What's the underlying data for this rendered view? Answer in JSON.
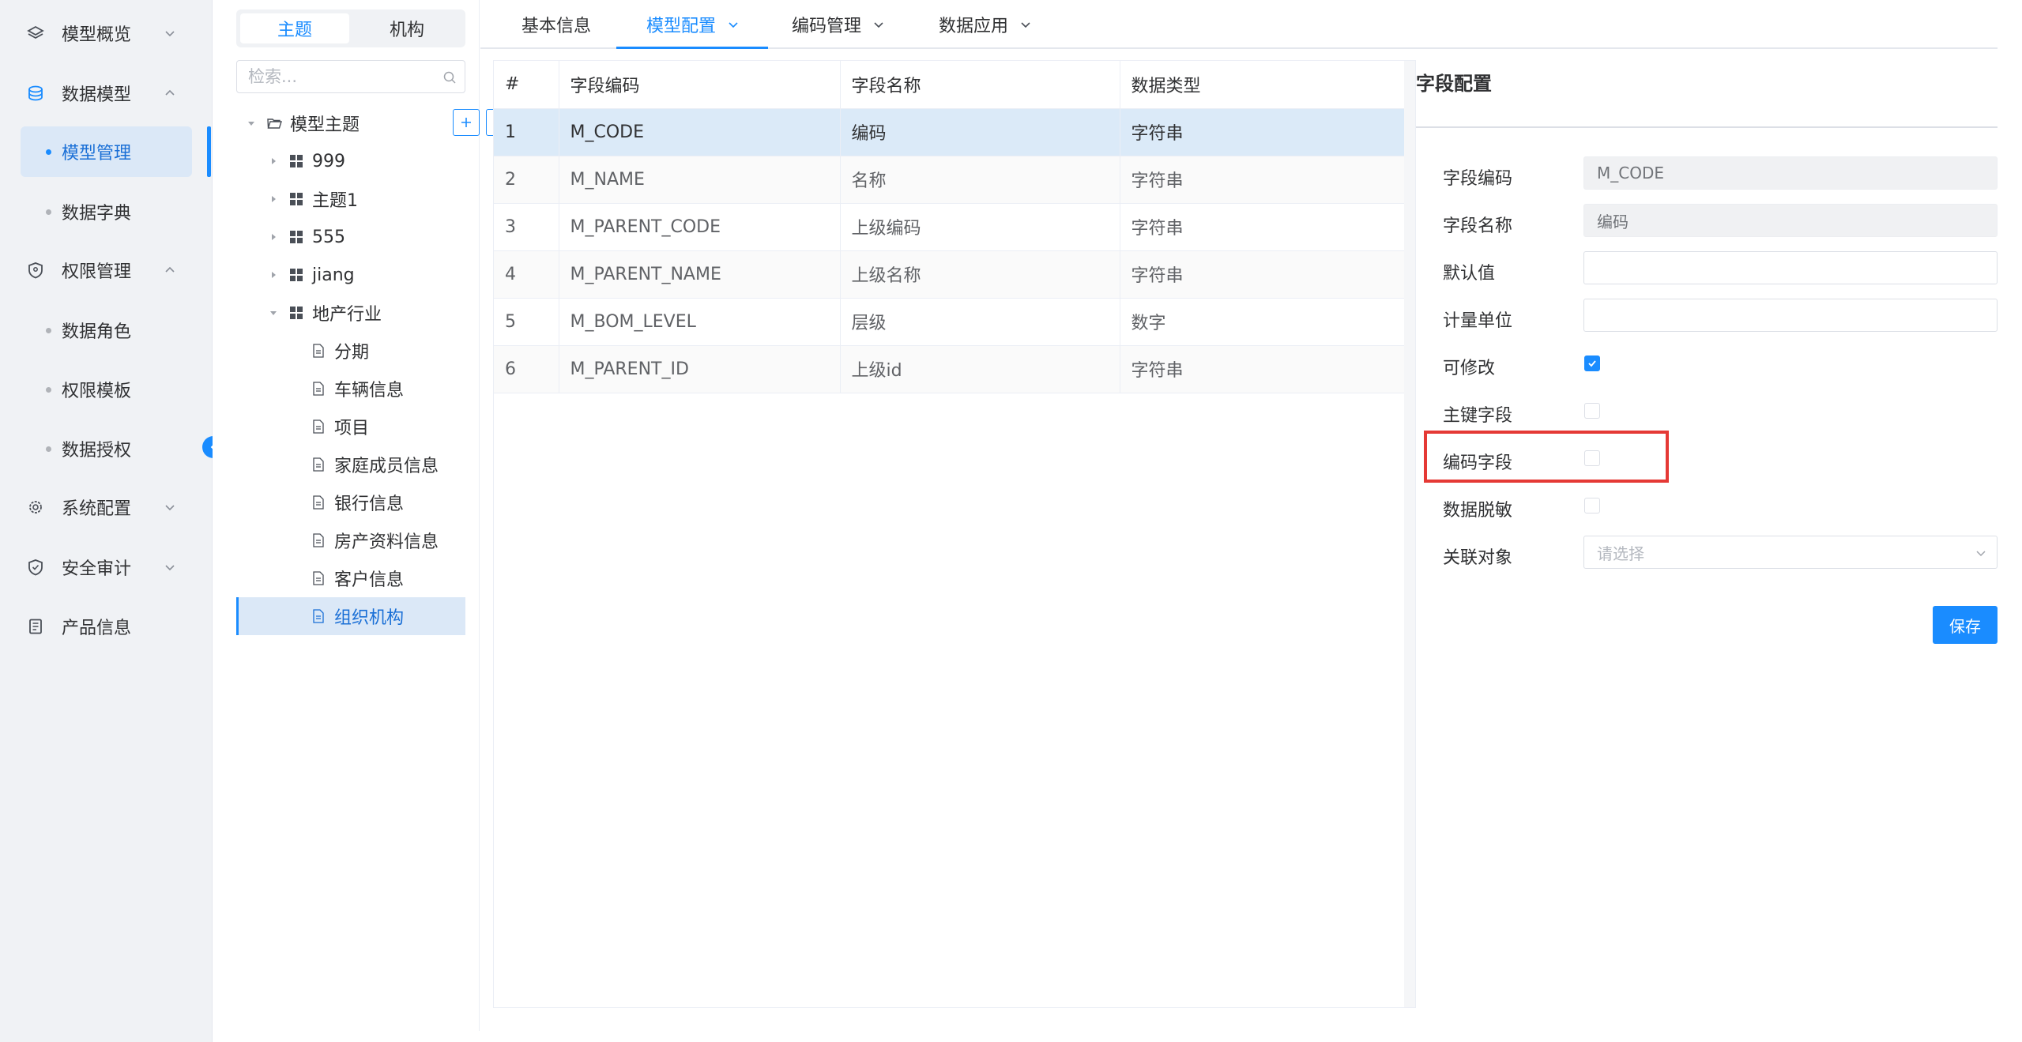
{
  "sidebar": {
    "items": [
      {
        "label": "模型概览",
        "icon": "layers-icon"
      },
      {
        "label": "数据模型",
        "icon": "database-icon"
      },
      {
        "label": "权限管理",
        "icon": "shield-icon"
      },
      {
        "label": "系统配置",
        "icon": "gear-icon"
      },
      {
        "label": "安全审计",
        "icon": "shield-check-icon"
      },
      {
        "label": "产品信息",
        "icon": "document-icon"
      }
    ],
    "data_model_sub": [
      "模型管理",
      "数据字典"
    ],
    "permission_sub": [
      "数据角色",
      "权限模板",
      "数据授权"
    ],
    "active_sub": "模型管理",
    "accent_color": "#1a8cff"
  },
  "tree": {
    "segments": [
      "主题",
      "机构"
    ],
    "active_segment": "主题",
    "search_placeholder": "检索...",
    "root": "模型主题",
    "nodes": [
      "999",
      "主题1",
      "555",
      "jiang",
      "地产行业"
    ],
    "children": [
      "分期",
      "车辆信息",
      "项目",
      "家庭成员信息",
      "银行信息",
      "房产资料信息",
      "客户信息",
      "组织机构"
    ],
    "selected": "组织机构"
  },
  "tabs": [
    {
      "label": "基本信息"
    },
    {
      "label": "模型配置"
    },
    {
      "label": "编码管理"
    },
    {
      "label": "数据应用"
    }
  ],
  "active_tab": "模型配置",
  "table": {
    "headers": [
      "#",
      "字段编码",
      "字段名称",
      "数据类型"
    ],
    "rows": [
      [
        "1",
        "M_CODE",
        "编码",
        "字符串"
      ],
      [
        "2",
        "M_NAME",
        "名称",
        "字符串"
      ],
      [
        "3",
        "M_PARENT_CODE",
        "上级编码",
        "字符串"
      ],
      [
        "4",
        "M_PARENT_NAME",
        "上级名称",
        "字符串"
      ],
      [
        "5",
        "M_BOM_LEVEL",
        "层级",
        "数字"
      ],
      [
        "6",
        "M_PARENT_ID",
        "上级id",
        "字符串"
      ]
    ],
    "selected_row": 1
  },
  "field_config": {
    "title": "字段配置",
    "code_label": "字段编码",
    "code_value": "M_CODE",
    "name_label": "字段名称",
    "name_value": "编码",
    "default_label": "默认值",
    "default_value": "",
    "unit_label": "计量单位",
    "unit_value": "",
    "editable_label": "可修改",
    "editable": true,
    "pk_label": "主键字段",
    "pk": false,
    "code_field_label": "编码字段",
    "code_field": false,
    "mask_label": "数据脱敏",
    "mask": false,
    "relation_label": "关联对象",
    "relation_placeholder": "请选择",
    "save_label": "保存",
    "highlight_color": "#e53935"
  }
}
